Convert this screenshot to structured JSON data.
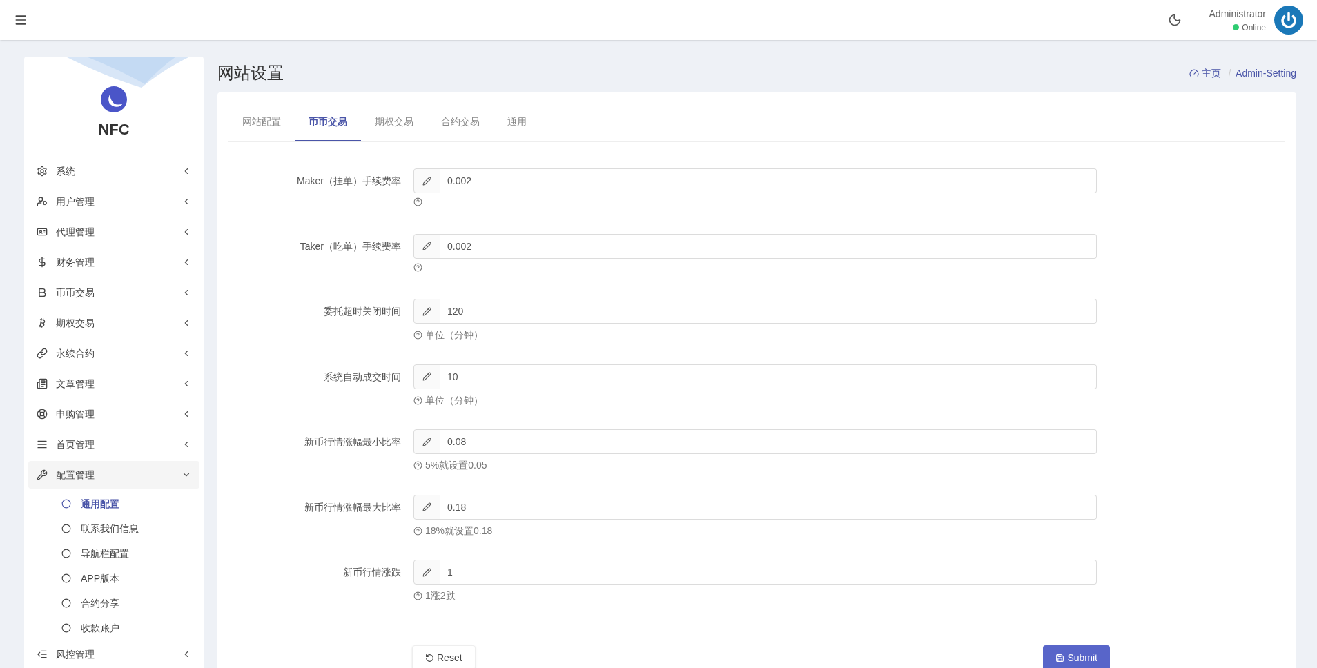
{
  "header": {
    "user_name": "Administrator",
    "status": "Online"
  },
  "sidebar": {
    "brand": "NFC",
    "items": [
      {
        "label": "系统",
        "expanded": false
      },
      {
        "label": "用户管理",
        "expanded": false
      },
      {
        "label": "代理管理",
        "expanded": false
      },
      {
        "label": "财务管理",
        "expanded": false
      },
      {
        "label": "币币交易",
        "expanded": false
      },
      {
        "label": "期权交易",
        "expanded": false
      },
      {
        "label": "永续合约",
        "expanded": false
      },
      {
        "label": "文章管理",
        "expanded": false
      },
      {
        "label": "申购管理",
        "expanded": false
      },
      {
        "label": "首页管理",
        "expanded": false
      },
      {
        "label": "配置管理",
        "expanded": true,
        "children": [
          {
            "label": "通用配置",
            "selected": true
          },
          {
            "label": "联系我们信息",
            "selected": false
          },
          {
            "label": "导航栏配置",
            "selected": false
          },
          {
            "label": "APP版本",
            "selected": false
          },
          {
            "label": "合约分享",
            "selected": false
          },
          {
            "label": "收款账户",
            "selected": false
          }
        ]
      },
      {
        "label": "风控管理",
        "expanded": false
      }
    ]
  },
  "page_title": "网站设置",
  "breadcrumb": [
    "主页",
    "Admin-Setting"
  ],
  "tabs": [
    {
      "label": "网站配置",
      "selected": false
    },
    {
      "label": "币币交易",
      "selected": true
    },
    {
      "label": "期权交易",
      "selected": false
    },
    {
      "label": "合约交易",
      "selected": false
    },
    {
      "label": "通用",
      "selected": false
    }
  ],
  "fields": [
    {
      "label": "Maker（挂单）手续费率",
      "value": "0.002"
    },
    {
      "label": "Taker（吃单）手续费率",
      "value": "0.002"
    },
    {
      "label": "委托超时关闭时间",
      "value": "120",
      "help": "单位（分钟）"
    },
    {
      "label": "系统自动成交时间",
      "value": "10",
      "help": "单位（分钟）"
    },
    {
      "label": "新币行情涨幅最小比率",
      "value": "0.08",
      "help": "5%就设置0.05"
    },
    {
      "label": "新币行情涨幅最大比率",
      "value": "0.18",
      "help": "18%就设置0.18"
    },
    {
      "label": "新币行情涨跌",
      "value": "1",
      "help": "1涨2跌"
    }
  ],
  "buttons": [
    {
      "kind": "reset",
      "label": "Reset"
    },
    {
      "kind": "submit",
      "label": "Submit"
    }
  ]
}
